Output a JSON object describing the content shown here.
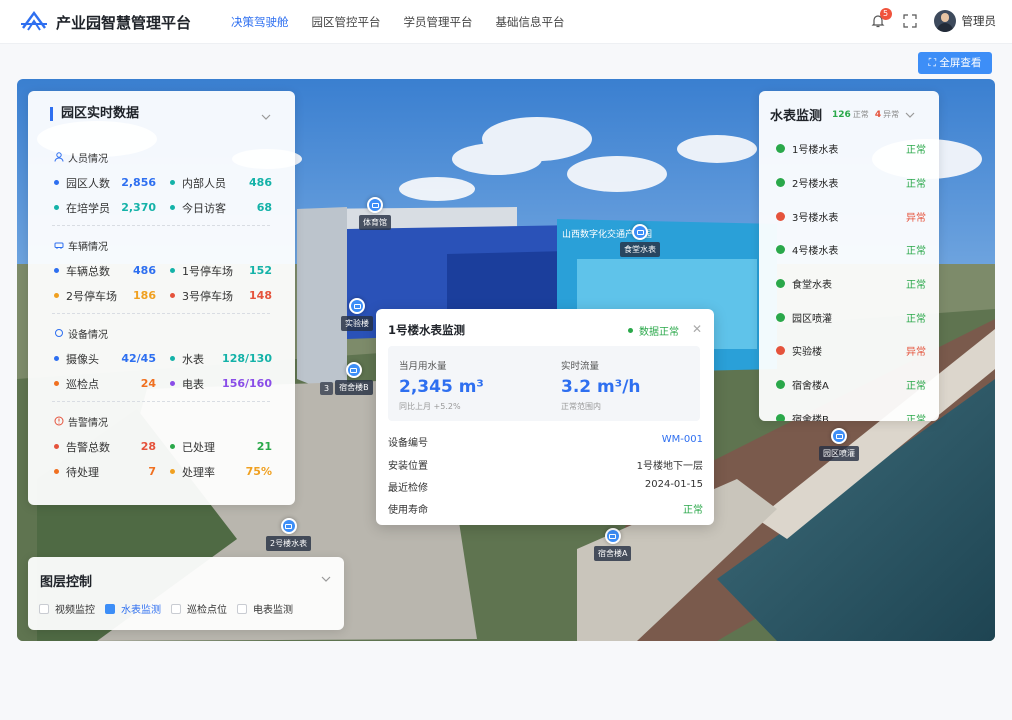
{
  "header": {
    "title": "产业园智慧管理平台",
    "nav": [
      "决策驾驶舱",
      "园区管控平台",
      "学员管理平台",
      "基础信息平台"
    ],
    "active_nav": 0,
    "notification_count": "5",
    "user_name": "管理员"
  },
  "fullscreen_label": "⛶ 全屏查看",
  "park_data": {
    "title": "园区实时数据",
    "sections": [
      {
        "title": "人员情况",
        "rows": [
          [
            {
              "label": "园区人数",
              "value": "2,856",
              "color": "#2e6ff0"
            },
            {
              "label": "内部人员",
              "value": "486",
              "color": "#14b2a8"
            }
          ],
          [
            {
              "label": "在培学员",
              "value": "2,370",
              "color": "#14b2a8"
            },
            {
              "label": "今日访客",
              "value": "68",
              "color": "#14b2a8"
            }
          ]
        ]
      },
      {
        "title": "车辆情况",
        "rows": [
          [
            {
              "label": "车辆总数",
              "value": "486",
              "color": "#2e6ff0"
            },
            {
              "label": "1号停车场",
              "value": "152",
              "color": "#14b2a8"
            }
          ],
          [
            {
              "label": "2号停车场",
              "value": "186",
              "color": "#f0a020"
            },
            {
              "label": "3号停车场",
              "value": "148",
              "color": "#e5533c"
            }
          ]
        ]
      },
      {
        "title": "设备情况",
        "rows": [
          [
            {
              "label": "摄像头",
              "value": "42/45",
              "color": "#2e6ff0"
            },
            {
              "label": "水表",
              "value": "128/130",
              "color": "#14b2a8"
            }
          ],
          [
            {
              "label": "巡检点",
              "value": "24",
              "color": "#f07020"
            },
            {
              "label": "电表",
              "value": "156/160",
              "color": "#8a4de8"
            }
          ]
        ]
      },
      {
        "title": "告警情况",
        "rows": [
          [
            {
              "label": "告警总数",
              "value": "28",
              "color": "#e5533c"
            },
            {
              "label": "已处理",
              "value": "21",
              "color": "#2aa84a"
            }
          ],
          [
            {
              "label": "待处理",
              "value": "7",
              "color": "#f07020"
            },
            {
              "label": "处理率",
              "value": "75%",
              "color": "#f0a020"
            }
          ]
        ]
      }
    ]
  },
  "water": {
    "title": "水表监测",
    "normal_count": "126",
    "normal_label": "正常",
    "abnormal_count": "4",
    "abnormal_label": "异常",
    "items": [
      {
        "name": "1号楼水表",
        "status": "正常",
        "ok": true
      },
      {
        "name": "2号楼水表",
        "status": "正常",
        "ok": true
      },
      {
        "name": "3号楼水表",
        "status": "异常",
        "ok": false
      },
      {
        "name": "4号楼水表",
        "status": "正常",
        "ok": true
      },
      {
        "name": "食堂水表",
        "status": "正常",
        "ok": true
      },
      {
        "name": "园区喷灌",
        "status": "正常",
        "ok": true
      },
      {
        "name": "实验楼",
        "status": "异常",
        "ok": false
      },
      {
        "name": "宿舍楼A",
        "status": "正常",
        "ok": true
      },
      {
        "name": "宿舍楼B",
        "status": "正常",
        "ok": true
      }
    ]
  },
  "popup": {
    "title": "1号楼水表监测",
    "status": "数据正常",
    "close": "✕",
    "usage_label": "当月用水量",
    "usage_value": "2,345 m³",
    "usage_sub": "同比上月 +5.2%",
    "flow_label": "实时流量",
    "flow_value": "3.2 m³/h",
    "flow_sub": "正常范围内",
    "details": [
      {
        "label": "设备编号",
        "value": "WM-001",
        "color": "#2e6ff0"
      },
      {
        "label": "安装位置",
        "value": "1号楼地下一层",
        "color": "#333333"
      },
      {
        "label": "最近检修",
        "value": "2024-01-15",
        "color": "#333333"
      },
      {
        "label": "使用寿命",
        "value": "正常",
        "color": "#2aa84a"
      }
    ]
  },
  "layers": {
    "title": "图层控制",
    "options": [
      {
        "label": "视频监控",
        "checked": false
      },
      {
        "label": "水表监测",
        "checked": true
      },
      {
        "label": "巡检点位",
        "checked": false
      },
      {
        "label": "电表监测",
        "checked": false
      }
    ]
  },
  "markers": [
    "体育馆",
    "食堂水表",
    "实验楼",
    "宿舍楼B",
    "园区喷灌",
    "2号楼水表",
    "宿舍楼A"
  ],
  "marker_prefix": "3",
  "signage": [
    "山西数字化交通产业园"
  ]
}
